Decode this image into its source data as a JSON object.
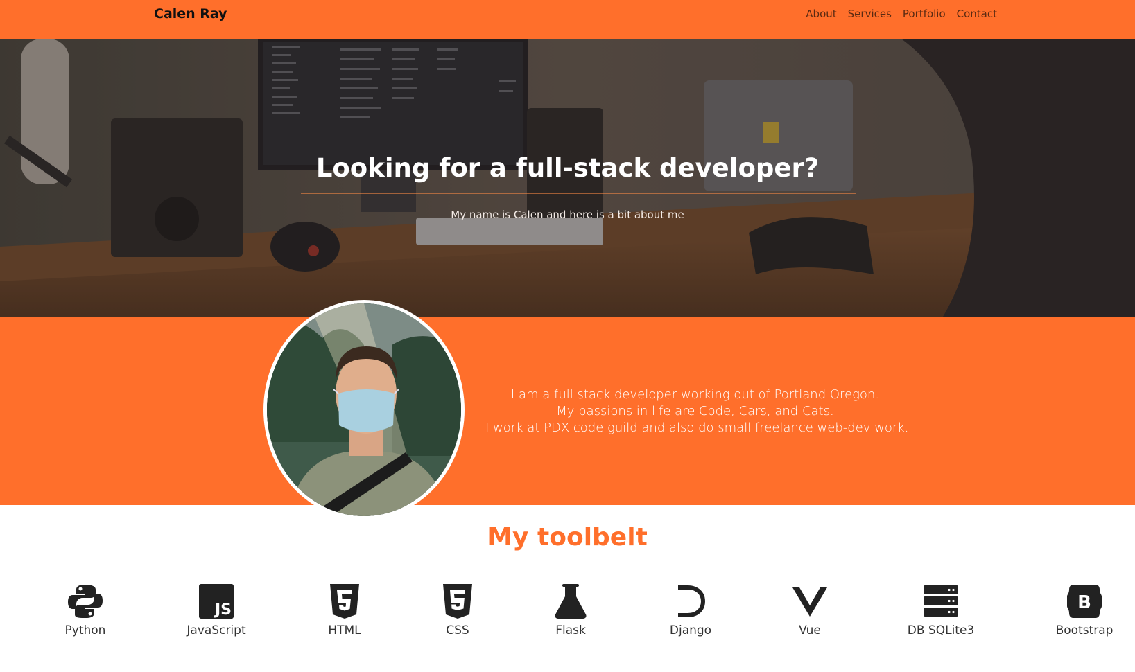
{
  "navbar": {
    "brand": "Calen Ray",
    "links": [
      "About",
      "Services",
      "Portfolio",
      "Contact"
    ]
  },
  "hero": {
    "title": "Looking for a full-stack developer?",
    "subtitle": "My name is Calen and here is a bit about me"
  },
  "about": {
    "lines": [
      "I am a full stack developer working out of Portland Oregon.",
      "My passions in life are Code, Cars, and Cats.",
      "I work at PDX code guild and also do small freelance web-dev work."
    ]
  },
  "toolbelt": {
    "title": "My toolbelt",
    "tools": [
      {
        "label": "Python",
        "icon": "python-icon"
      },
      {
        "label": "JavaScript",
        "icon": "javascript-icon"
      },
      {
        "label": "HTML",
        "icon": "html5-icon"
      },
      {
        "label": "CSS",
        "icon": "css3-icon"
      },
      {
        "label": "Flask",
        "icon": "flask-icon"
      },
      {
        "label": "Django",
        "icon": "django-icon"
      },
      {
        "label": "Vue",
        "icon": "vue-icon"
      },
      {
        "label": "DB SQLite3",
        "icon": "database-icon"
      },
      {
        "label": "Bootstrap",
        "icon": "bootstrap-icon"
      }
    ]
  },
  "colors": {
    "accent": "#ff6f2b",
    "icon": "#222222",
    "text_dark": "#111111"
  }
}
